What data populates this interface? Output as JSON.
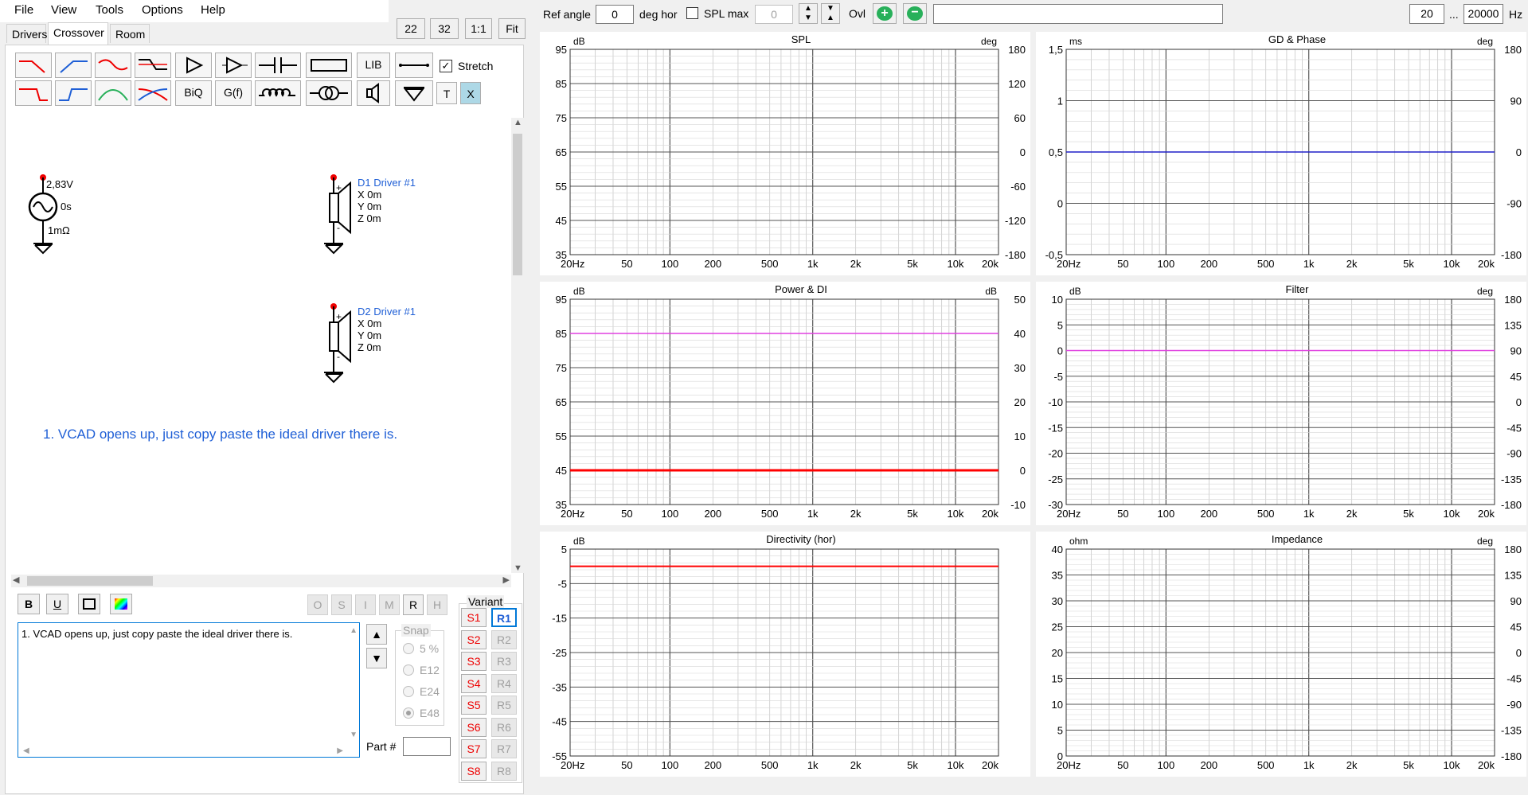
{
  "menu": [
    "File",
    "View",
    "Tools",
    "Options",
    "Help"
  ],
  "zoom_buttons": [
    "22",
    "32",
    "1:1",
    "Fit"
  ],
  "tabs": [
    "Drivers",
    "Crossover",
    "Room"
  ],
  "toolbar": {
    "lib": "LIB",
    "biq": "BiQ",
    "gf": "G(f)",
    "t": "T",
    "x": "X",
    "stretch": "Stretch"
  },
  "schematic": {
    "source_voltage": "2,83V",
    "source_delay": "0s",
    "source_impedance": "1mΩ",
    "d1_name": "D1 Driver #1",
    "d1_x": "X 0m",
    "d1_y": "Y 0m",
    "d1_z": "Z 0m",
    "d2_name": "D2 Driver #1",
    "d2_x": "X 0m",
    "d2_y": "Y 0m",
    "d2_z": "Z 0m",
    "note": "1. VCAD opens up, just copy paste the ideal driver there is."
  },
  "format_buttons": [
    "B",
    "U"
  ],
  "option_buttons": [
    "O",
    "S",
    "I",
    "M",
    "R",
    "H"
  ],
  "note_text": "1. VCAD opens up, just copy paste the ideal driver there is.",
  "snap": {
    "label": "Snap",
    "options": [
      "5 %",
      "E12",
      "E24",
      "E48"
    ],
    "selected": "E48"
  },
  "part_label": "Part #",
  "variant": {
    "label": "Variant",
    "s": [
      "S1",
      "S2",
      "S3",
      "S4",
      "S5",
      "S6",
      "S7",
      "S8"
    ],
    "r": [
      "R1",
      "R2",
      "R3",
      "R4",
      "R5",
      "R6",
      "R7",
      "R8"
    ]
  },
  "top": {
    "ref_angle_label": "Ref angle",
    "ref_angle_value": "0",
    "deg_hor": "deg hor",
    "spl_max_label": "SPL max",
    "spl_max_value": "0",
    "ovl_label": "Ovl",
    "freq_from": "20",
    "freq_dots": "...",
    "freq_to": "20000",
    "hz": "Hz"
  },
  "colors": {
    "red": "#ff0000",
    "blue": "#1f5fd6",
    "magenta": "#e040e0",
    "navy": "#2020c8",
    "green": "#28b05a"
  },
  "chart_data": [
    {
      "type": "line",
      "title": "SPL",
      "yunit_left": "dB",
      "yunit_right": "deg",
      "x_ticks": [
        "20Hz",
        "50",
        "100",
        "200",
        "500",
        "1k",
        "2k",
        "5k",
        "10k",
        "20k"
      ],
      "y_ticks_left": [
        "95",
        "85",
        "75",
        "65",
        "55",
        "45",
        "35"
      ],
      "y_ticks_right": [
        "180",
        "120",
        "60",
        "0",
        "-60",
        "-120",
        "-180"
      ],
      "ylim": [
        35,
        95
      ],
      "series": []
    },
    {
      "type": "line",
      "title": "GD & Phase",
      "yunit_left": "ms",
      "yunit_right": "deg",
      "x_ticks": [
        "20Hz",
        "50",
        "100",
        "200",
        "500",
        "1k",
        "2k",
        "5k",
        "10k",
        "20k"
      ],
      "y_ticks_left": [
        "1,5",
        "1",
        "0,5",
        "0",
        "-0,5"
      ],
      "y_ticks_right": [
        "180",
        "90",
        "0",
        "-90",
        "-180"
      ],
      "ylim": [
        -0.5,
        1.5
      ],
      "series": [
        {
          "values": [
            0.5,
            0.5
          ],
          "color": "#2020c8"
        }
      ]
    },
    {
      "type": "line",
      "title": "Power & DI",
      "yunit_left": "dB",
      "yunit_right": "dB",
      "x_ticks": [
        "20Hz",
        "50",
        "100",
        "200",
        "500",
        "1k",
        "2k",
        "5k",
        "10k",
        "20k"
      ],
      "y_ticks_left": [
        "95",
        "85",
        "75",
        "65",
        "55",
        "45",
        "35"
      ],
      "y_ticks_right": [
        "50",
        "40",
        "30",
        "20",
        "10",
        "0",
        "-10"
      ],
      "ylim": [
        35,
        95
      ],
      "series": [
        {
          "values": [
            85,
            85
          ],
          "color": "#e040e0"
        },
        {
          "values": [
            45,
            45
          ],
          "color": "#ff0000",
          "width": 3
        }
      ]
    },
    {
      "type": "line",
      "title": "Filter",
      "yunit_left": "dB",
      "yunit_right": "deg",
      "x_ticks": [
        "20Hz",
        "50",
        "100",
        "200",
        "500",
        "1k",
        "2k",
        "5k",
        "10k",
        "20k"
      ],
      "y_ticks_left": [
        "10",
        "5",
        "0",
        "-5",
        "-10",
        "-15",
        "-20",
        "-25",
        "-30"
      ],
      "y_ticks_right": [
        "180",
        "135",
        "90",
        "45",
        "0",
        "-45",
        "-90",
        "-135",
        "-180"
      ],
      "ylim": [
        -30,
        10
      ],
      "series": [
        {
          "values": [
            0,
            0
          ],
          "color": "#e040e0"
        }
      ]
    },
    {
      "type": "line",
      "title": "Directivity (hor)",
      "yunit_left": "dB",
      "yunit_right": "",
      "x_ticks": [
        "20Hz",
        "50",
        "100",
        "200",
        "500",
        "1k",
        "2k",
        "5k",
        "10k",
        "20k"
      ],
      "y_ticks_left": [
        "5",
        "-5",
        "-15",
        "-25",
        "-35",
        "-45",
        "-55"
      ],
      "y_ticks_right": [],
      "ylim": [
        -55,
        5
      ],
      "series": [
        {
          "values": [
            0,
            0
          ],
          "color": "#ff0000",
          "width": 2
        }
      ]
    },
    {
      "type": "line",
      "title": "Impedance",
      "yunit_left": "ohm",
      "yunit_right": "deg",
      "x_ticks": [
        "20Hz",
        "50",
        "100",
        "200",
        "500",
        "1k",
        "2k",
        "5k",
        "10k",
        "20k"
      ],
      "y_ticks_left": [
        "40",
        "35",
        "30",
        "25",
        "20",
        "15",
        "10",
        "5",
        "0"
      ],
      "y_ticks_right": [
        "180",
        "135",
        "90",
        "45",
        "0",
        "-45",
        "-90",
        "-135",
        "-180"
      ],
      "ylim": [
        0,
        40
      ],
      "series": []
    }
  ]
}
